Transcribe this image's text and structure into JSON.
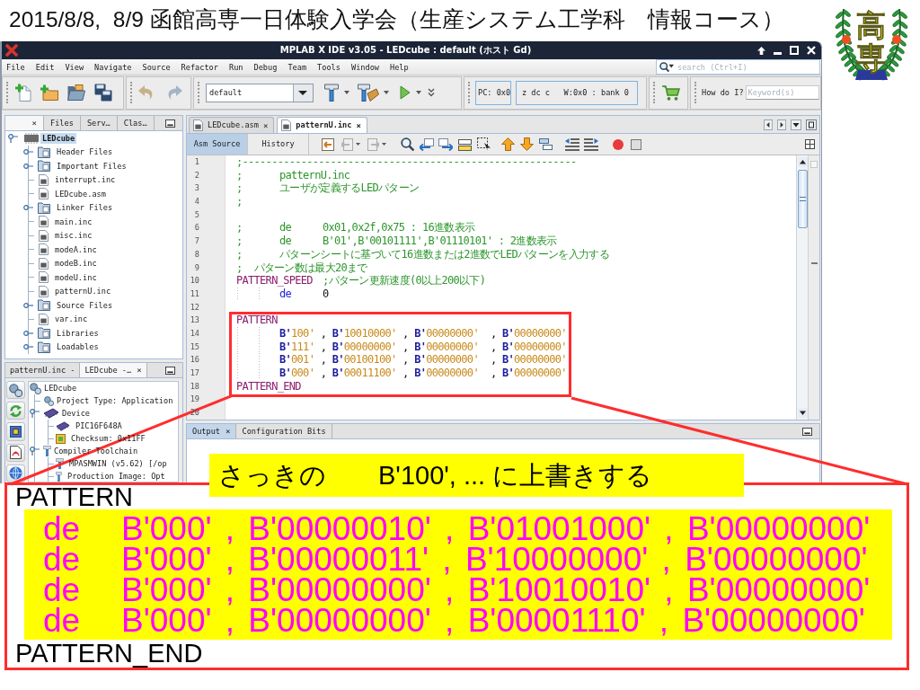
{
  "slide_title": "2015/8/8,  8/9 函館高専一日体験入学会（生産システム工学科　情報コース）",
  "logo": {
    "text": "高専"
  },
  "window": {
    "title": "MPLAB X IDE v3.05 - LEDcube : default (ホスト Gd)"
  },
  "menu": [
    "File",
    "Edit",
    "View",
    "Navigate",
    "Source",
    "Refactor",
    "Run",
    "Debug",
    "Team",
    "Tools",
    "Window",
    "Help"
  ],
  "search": {
    "placeholder": "search (Ctrl+I)"
  },
  "toolbar": {
    "configuration": "default",
    "pc": "PC: 0x0",
    "status": "z dc c   W:0x0 : bank 0",
    "help_label": "How do I?",
    "help_placeholder": "Keyword(s)"
  },
  "projects_panel": {
    "tabs": [
      {
        "close": "×",
        "selected": true
      },
      {
        "label": "Files",
        "selected": false
      },
      {
        "label": "Serv…",
        "selected": false
      },
      {
        "label": "Clas…",
        "selected": false
      }
    ],
    "tree": [
      {
        "label": "LEDcube",
        "kind": "project",
        "selected": true,
        "expanded": true,
        "children": [
          {
            "label": "Header Files",
            "kind": "folder",
            "selected": false,
            "expanded": false
          },
          {
            "label": "Important Files",
            "kind": "folder",
            "selected": false,
            "expanded": false
          },
          {
            "label": "interrupt.inc",
            "kind": "file",
            "selected": false
          },
          {
            "label": "LEDcube.asm",
            "kind": "file",
            "selected": false
          },
          {
            "label": "Linker Files",
            "kind": "folder",
            "selected": false,
            "expanded": false
          },
          {
            "label": "main.inc",
            "kind": "file",
            "selected": false
          },
          {
            "label": "misc.inc",
            "kind": "file",
            "selected": false
          },
          {
            "label": "modeA.inc",
            "kind": "file",
            "selected": false
          },
          {
            "label": "modeB.inc",
            "kind": "file",
            "selected": false
          },
          {
            "label": "modeU.inc",
            "kind": "file",
            "selected": false
          },
          {
            "label": "patternU.inc",
            "kind": "file",
            "selected": false
          },
          {
            "label": "Source Files",
            "kind": "folder",
            "selected": false,
            "expanded": false
          },
          {
            "label": "var.inc",
            "kind": "file",
            "selected": false
          },
          {
            "label": "Libraries",
            "kind": "folder",
            "selected": false,
            "expanded": false
          },
          {
            "label": "Loadables",
            "kind": "folder",
            "selected": false,
            "expanded": false
          }
        ]
      }
    ]
  },
  "dashboard_panel": {
    "tabs": [
      {
        "label": "patternU.inc -",
        "selected": false
      },
      {
        "label": "LEDcube -…",
        "selected": true,
        "close": "×"
      }
    ],
    "tree": [
      {
        "label": "LEDcube",
        "kind": "project",
        "children": [
          {
            "label": "Project Type: Application",
            "kind": "info"
          },
          {
            "label": "Device",
            "kind": "device",
            "expanded": true,
            "children": [
              {
                "label": "PIC16F648A",
                "kind": "chip"
              },
              {
                "label": "Checksum: 0x11FF",
                "kind": "checksum"
              }
            ]
          },
          {
            "label": "Compiler Toolchain",
            "kind": "toolchain",
            "expanded": true,
            "children": [
              {
                "label": "MPASMWIN (v5.62) [/op",
                "kind": "tool"
              },
              {
                "label": "Production Image: Opt",
                "kind": "image"
              }
            ]
          }
        ]
      }
    ]
  },
  "editor": {
    "tabs": [
      {
        "label": "LEDcube.asm",
        "selected": false,
        "close": "×"
      },
      {
        "label": "patternU.inc",
        "selected": true,
        "close": "×"
      }
    ],
    "views": [
      {
        "label": "Asm Source",
        "selected": true
      },
      {
        "label": "History",
        "selected": false
      }
    ],
    "lines": [
      {
        "number": "1",
        "tokens": [
          {
            "kind": "comment",
            "text": ";---------------------------------------------------------"
          }
        ]
      },
      {
        "number": "2",
        "tokens": [
          {
            "kind": "comment",
            "text": ";\tpatternU.inc"
          }
        ]
      },
      {
        "number": "3",
        "tokens": [
          {
            "kind": "comment",
            "text": ";\tユーザが定義するLEDパターン"
          }
        ]
      },
      {
        "number": "4",
        "tokens": [
          {
            "kind": "comment",
            "text": ";"
          }
        ]
      },
      {
        "number": "5"
      },
      {
        "number": "6",
        "tokens": [
          {
            "kind": "comment",
            "text": ";\tde\t0x01,0x2f,0x75 : 16進数表示"
          }
        ]
      },
      {
        "number": "7",
        "tokens": [
          {
            "kind": "comment",
            "text": ";\tde\tB'01',B'00101111',B'01110101' : 2進数表示"
          }
        ]
      },
      {
        "number": "8",
        "tokens": [
          {
            "kind": "comment",
            "text": ";\tパターンシートに基づいて16進数または2進数でLEDパターンを入力する"
          }
        ]
      },
      {
        "number": "9",
        "tokens": [
          {
            "kind": "comment",
            "text": ";  パターン数は最大20まで"
          }
        ]
      },
      {
        "number": "10",
        "tokens": [
          {
            "kind": "label",
            "text": "PATTERN_SPEED"
          },
          {
            "kind": "comment",
            "text": "\t;パターン更新速度(0以上200以下)"
          }
        ]
      },
      {
        "number": "11",
        "indented": true,
        "tokens": [
          {
            "kind": "directive",
            "text": "de"
          },
          {
            "kind": "plain",
            "text": "\t0"
          }
        ]
      },
      {
        "number": "12"
      },
      {
        "number": "13",
        "tokens": [
          {
            "kind": "label",
            "text": "PATTERN"
          }
        ]
      },
      {
        "number": "14",
        "indented": true,
        "tokens": [
          {
            "kind": "binary",
            "text": "B'100'"
          },
          {
            "kind": "plain",
            "text": " , "
          },
          {
            "kind": "binary",
            "text": "B'10010000'"
          },
          {
            "kind": "plain",
            "text": " , "
          },
          {
            "kind": "binary",
            "text": "B'00000000'"
          },
          {
            "kind": "plain",
            "text": "  , "
          },
          {
            "kind": "binary",
            "text": "B'00000000'"
          }
        ]
      },
      {
        "number": "15",
        "indented": true,
        "tokens": [
          {
            "kind": "binary",
            "text": "B'111'"
          },
          {
            "kind": "plain",
            "text": " , "
          },
          {
            "kind": "binary",
            "text": "B'00000000'"
          },
          {
            "kind": "plain",
            "text": " , "
          },
          {
            "kind": "binary",
            "text": "B'00000000'"
          },
          {
            "kind": "plain",
            "text": "  , "
          },
          {
            "kind": "binary",
            "text": "B'00000000'"
          }
        ]
      },
      {
        "number": "16",
        "indented": true,
        "tokens": [
          {
            "kind": "binary",
            "text": "B'001'"
          },
          {
            "kind": "plain",
            "text": " , "
          },
          {
            "kind": "binary",
            "text": "B'00100100'"
          },
          {
            "kind": "plain",
            "text": " , "
          },
          {
            "kind": "binary",
            "text": "B'00000000'"
          },
          {
            "kind": "plain",
            "text": "  , "
          },
          {
            "kind": "binary",
            "text": "B'00000000'"
          }
        ]
      },
      {
        "number": "17",
        "indented": true,
        "tokens": [
          {
            "kind": "binary",
            "text": "B'000'"
          },
          {
            "kind": "plain",
            "text": " , "
          },
          {
            "kind": "binary",
            "text": "B'00011100'"
          },
          {
            "kind": "plain",
            "text": " , "
          },
          {
            "kind": "binary",
            "text": "B'00000000'"
          },
          {
            "kind": "plain",
            "text": "  , "
          },
          {
            "kind": "binary",
            "text": "B'00000000'"
          }
        ]
      },
      {
        "number": "18",
        "tokens": [
          {
            "kind": "label",
            "text": "PATTERN_END"
          }
        ]
      },
      {
        "number": "19"
      },
      {
        "number": "20"
      }
    ]
  },
  "output": {
    "tabs": [
      {
        "label": "Output",
        "selected": true,
        "close": "×"
      },
      {
        "label": "Configuration Bits",
        "selected": false
      }
    ]
  },
  "callout": {
    "label": "さっきの　　B'100', ... に上書きする",
    "code_start": "PATTERN",
    "rows": [
      "de   B'000' , B'00000010' , B'01001000' , B'00000000'",
      "de   B'000' , B'00000011' , B'10000000' , B'00000000'",
      "de   B'000' , B'00000000' , B'10010010' , B'00000000'",
      "de   B'000' , B'00000000' , B'00001110' , B'00000000'"
    ],
    "code_end": "PATTERN_END"
  }
}
